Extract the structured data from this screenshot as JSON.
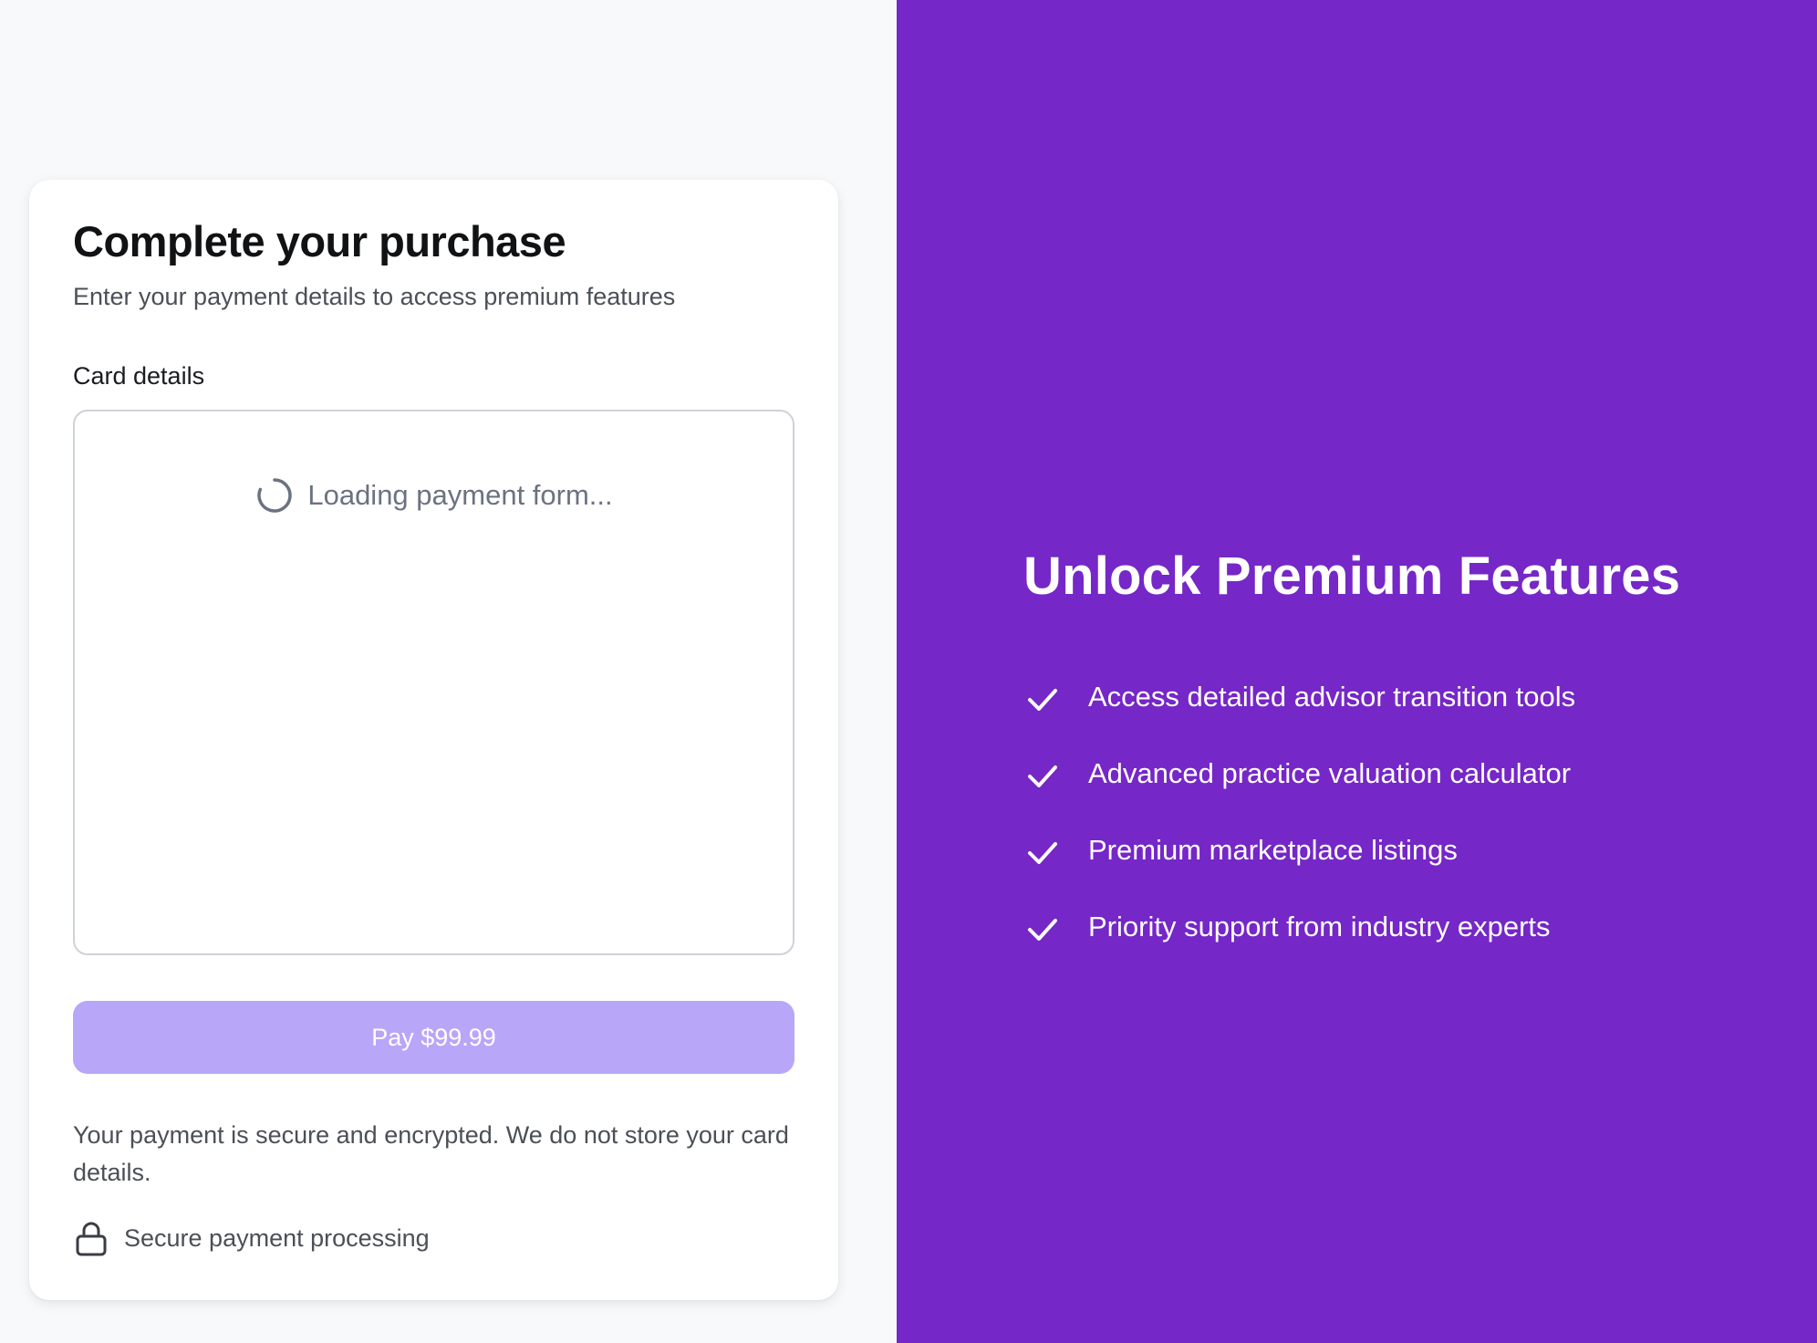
{
  "checkout": {
    "title": "Complete your purchase",
    "subtitle": "Enter your payment details to access premium features",
    "card_label": "Card details",
    "loading_text": "Loading payment form...",
    "pay_button_label": "Pay $99.99",
    "pay_button_disabled": true,
    "security_note": "Your payment is secure and encrypted. We do not store your card details.",
    "secure_badge": "Secure payment processing",
    "icons": {
      "spinner": "loading-spinner-icon",
      "lock": "lock-icon"
    }
  },
  "promo": {
    "title": "Unlock Premium Features",
    "features": [
      {
        "text": "Access detailed advisor transition tools",
        "icon": "check-icon"
      },
      {
        "text": "Advanced practice valuation calculator",
        "icon": "check-icon"
      },
      {
        "text": "Premium marketplace listings",
        "icon": "check-icon"
      },
      {
        "text": "Priority support from industry experts",
        "icon": "check-icon"
      }
    ]
  },
  "colors": {
    "page_background": "#f8f9fb",
    "card_background": "#ffffff",
    "promo_background": "#7527c7",
    "pay_button_disabled": "#b8a6f8",
    "heading_text": "#111214",
    "muted_text": "#4b4f57",
    "loading_text": "#6b7280"
  }
}
